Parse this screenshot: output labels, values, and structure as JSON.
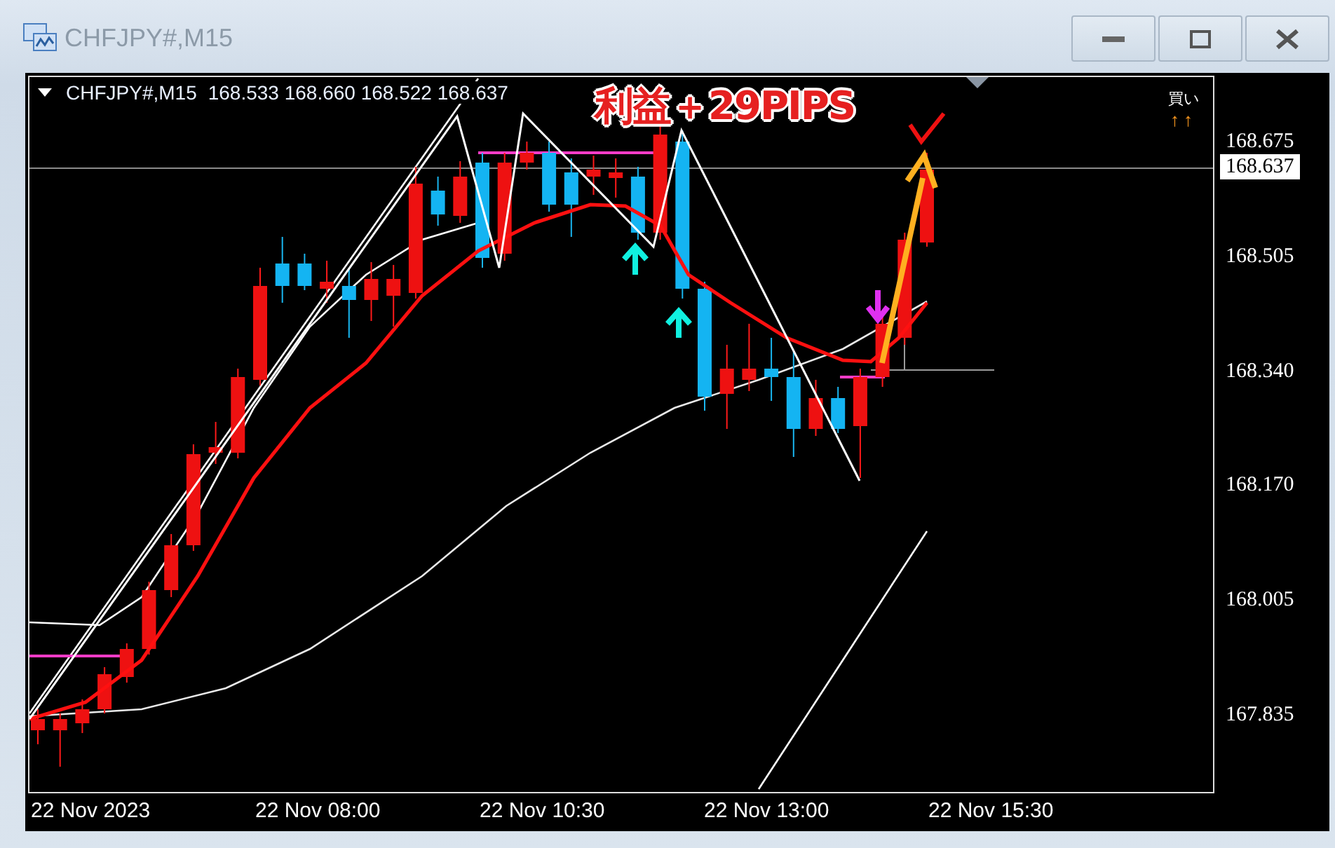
{
  "window": {
    "title": "CHFJPY#,M15"
  },
  "chart": {
    "symbol": "CHFJPY#,M15",
    "ohlc": "168.533 168.660 168.522 168.637",
    "annotation": "利益＋29PIPS",
    "signal": {
      "label": "買い",
      "arrows": "↑↑"
    },
    "price_labels": [
      "168.675",
      "168.505",
      "168.340",
      "168.170",
      "168.005",
      "167.835"
    ],
    "current_price": "168.637",
    "time_labels": [
      "22 Nov 2023",
      "22 Nov 08:00",
      "22 Nov 10:30",
      "22 Nov 13:00",
      "22 Nov 15:30"
    ]
  }
}
